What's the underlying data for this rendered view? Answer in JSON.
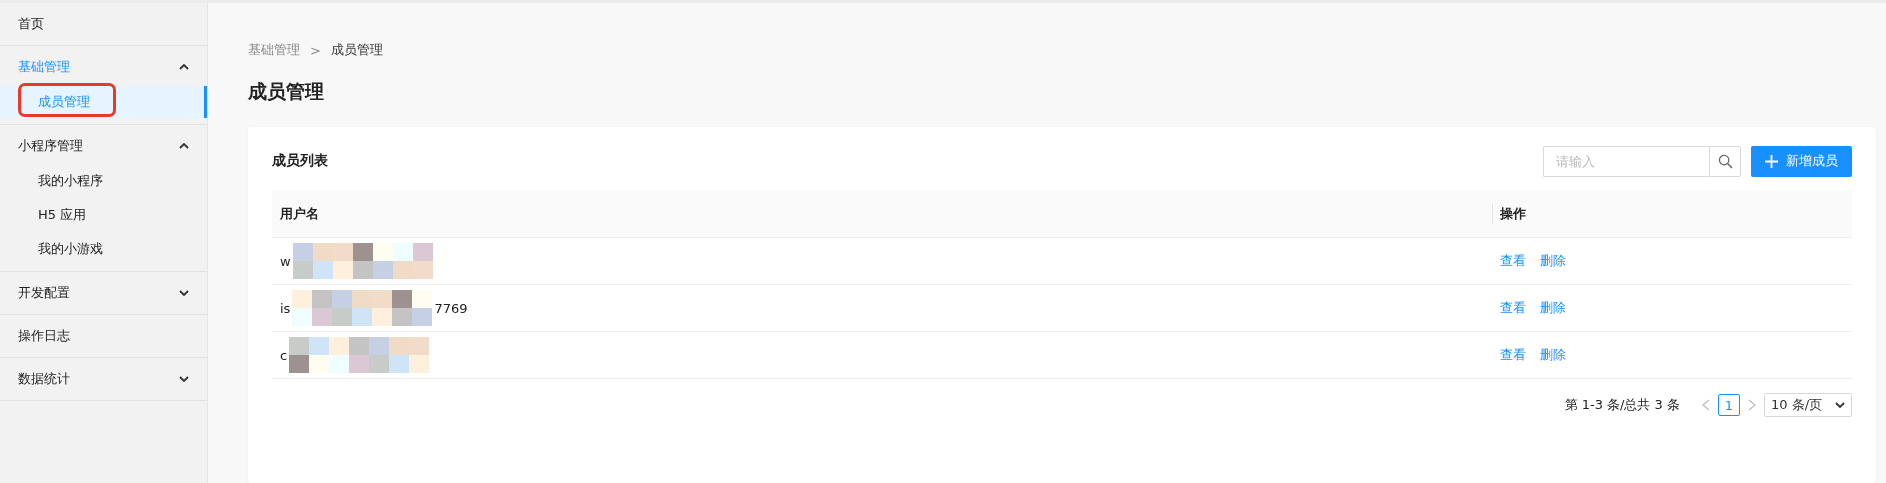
{
  "sidebar": {
    "items": [
      {
        "kind": "link",
        "label": "首页",
        "selected": false
      },
      {
        "kind": "group",
        "label": "基础管理",
        "expanded": true,
        "selected": true,
        "children": [
          {
            "label": "成员管理",
            "selected": true,
            "highlighted": true
          }
        ]
      },
      {
        "kind": "group",
        "label": "小程序管理",
        "expanded": true,
        "selected": false,
        "children": [
          {
            "label": "我的小程序",
            "selected": false,
            "highlighted": false
          },
          {
            "label": "H5 应用",
            "selected": false,
            "highlighted": false
          },
          {
            "label": "我的小游戏",
            "selected": false,
            "highlighted": false
          }
        ]
      },
      {
        "kind": "group",
        "label": "开发配置",
        "expanded": false,
        "selected": false
      },
      {
        "kind": "link",
        "label": "操作日志",
        "selected": false
      },
      {
        "kind": "group",
        "label": "数据统计",
        "expanded": false,
        "selected": false
      }
    ]
  },
  "breadcrumb": [
    "基础管理",
    "成员管理"
  ],
  "breadcrumb_separator": ">",
  "page_title": "成员管理",
  "card": {
    "title": "成员列表",
    "search": {
      "placeholder": "请输入"
    },
    "add_button": "新增成员",
    "table": {
      "columns": [
        "用户名",
        "操作"
      ],
      "rows": [
        {
          "username": {
            "start": "w",
            "redacted": true
          },
          "actions": [
            "查看",
            "删除"
          ]
        },
        {
          "username": {
            "start": "is",
            "redacted": true,
            "end": "7769"
          },
          "actions": [
            "查看",
            "删除"
          ]
        },
        {
          "username": {
            "start": "c",
            "redacted": true
          },
          "actions": [
            "查看",
            "删除"
          ]
        }
      ]
    },
    "pagination": {
      "summary": "第 1-3 条/总共 3 条",
      "pages": [
        {
          "label": "1",
          "selected": true
        }
      ],
      "page_size": "10 条/页"
    }
  }
}
